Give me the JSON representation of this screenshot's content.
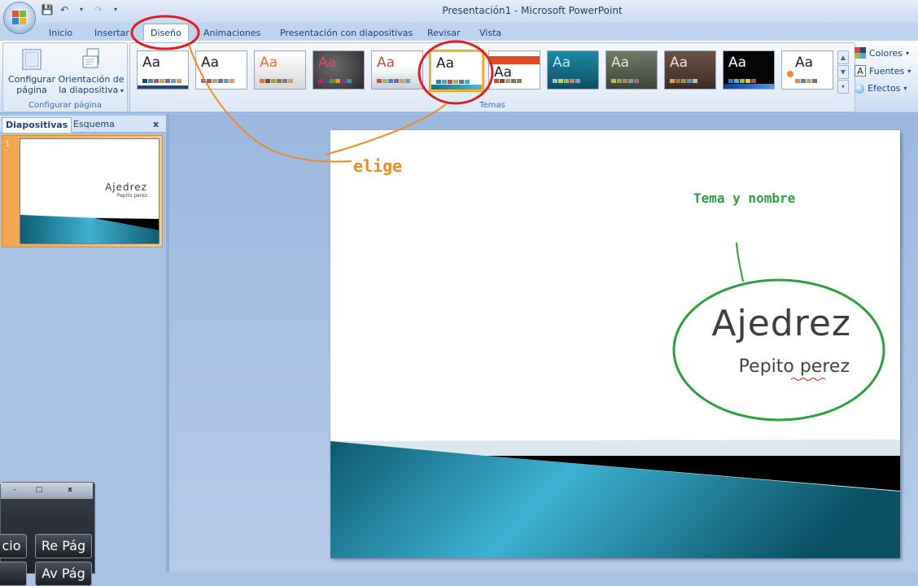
{
  "window": {
    "title": "Presentación1 - Microsoft PowerPoint"
  },
  "quick_access": {
    "icons": [
      "save-icon",
      "undo-icon",
      "redo-icon",
      "customize-icon"
    ]
  },
  "tabs": [
    {
      "label": "Inicio"
    },
    {
      "label": "Insertar"
    },
    {
      "label": "Diseño"
    },
    {
      "label": "Animaciones"
    },
    {
      "label": "Presentación con diapositivas"
    },
    {
      "label": "Revisar"
    },
    {
      "label": "Vista"
    }
  ],
  "page_setup": {
    "configurar_label_1": "Configurar",
    "configurar_label_2": "página",
    "orientacion_label_1": "Orientación de",
    "orientacion_label_2": "la diapositiva",
    "group_label": "Configurar página"
  },
  "themes": {
    "group_label": "Temas",
    "sample_text": "Aa",
    "selected_index": 5
  },
  "theme_options": {
    "colores": "Colores",
    "fuentes": "Fuentes",
    "efectos": "Efectos"
  },
  "slide_pane": {
    "tab_slides": "Diapositivas",
    "tab_outline": "Esquema",
    "close_label": "x",
    "slide_number": "1"
  },
  "slide": {
    "title": "Ajedrez",
    "subtitle": "Pepito perez"
  },
  "keyboard_widget": {
    "key_inicio": "cio",
    "key_re_pag": "Re Pág",
    "key_av_pag": "Av Pág",
    "close_label": "x"
  },
  "annotations": {
    "elige": "elige",
    "tema_nombre": "Tema y nombre"
  },
  "colors": {
    "accent_teal": "#1b8aa3",
    "annotation_red": "#e02020",
    "annotation_orange": "#f28a20",
    "annotation_green": "#2aa040"
  }
}
